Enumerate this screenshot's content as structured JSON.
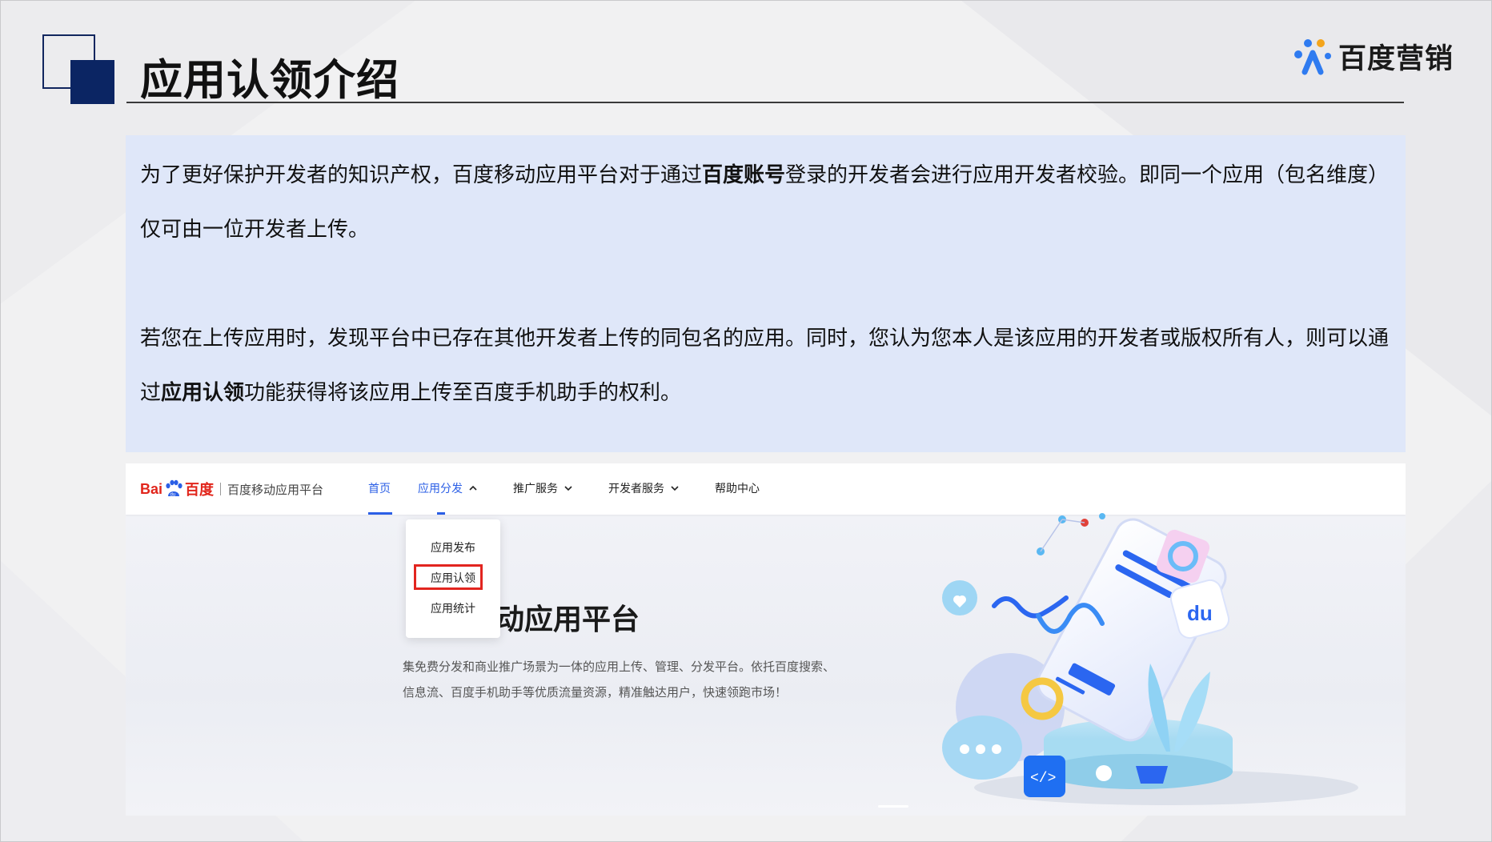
{
  "slide": {
    "title": "应用认领介绍",
    "brand": "百度营销"
  },
  "intro": {
    "p1_a": "为了更好保护开发者的知识产权，百度移动应用平台对于通过",
    "p1_bold": "百度账号",
    "p1_b": "登录的开发者会进行应用开发者校验。即同一个应用（包名维度）仅可由一位开发者上传。",
    "p2_a": "若您在上传应用时，发现平台中已存在其他开发者上传的同包名的应用。同时，您认为您本人是该应用的开发者或版权所有人，则可以通过",
    "p2_bold": "应用认领",
    "p2_b": "功能获得将该应用上传至百度手机助手的权利。"
  },
  "screenshot": {
    "logo_left": "Bai",
    "logo_right": "百度",
    "platform": "百度移动应用平台",
    "nav": {
      "home": "首页",
      "distribution": "应用分发",
      "promotion": "推广服务",
      "developer": "开发者服务",
      "help": "帮助中心"
    },
    "dropdown": {
      "publish": "应用发布",
      "claim": "应用认领",
      "stats": "应用统计"
    },
    "hero_title_visible": "动应用平台",
    "hero_desc_line1": "集免费分发和商业推广场景为一体的应用上传、管理、分发平台。依托百度搜索、",
    "hero_desc_line2": "信息流、百度手机助手等优质流量资源，精准触达用户，快速领跑市场！"
  },
  "colors": {
    "accent_blue": "#2b5fe6",
    "highlight_red": "#e2251f",
    "deco_navy": "#0b2563",
    "intro_bg": "#dfe7f9"
  }
}
